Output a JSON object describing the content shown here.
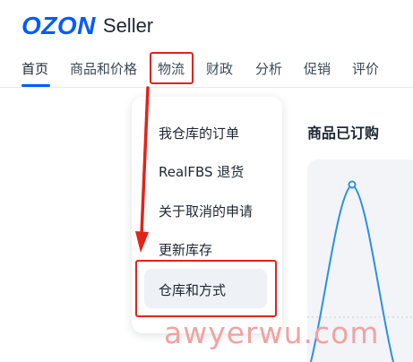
{
  "header": {
    "logo_text": "OZON",
    "logo_subtitle": "Seller"
  },
  "nav": {
    "items": [
      {
        "label": "首页",
        "active": true
      },
      {
        "label": "商品和价格",
        "active": false
      },
      {
        "label": "物流",
        "active": false,
        "highlighted": true
      },
      {
        "label": "财政",
        "active": false
      },
      {
        "label": "分析",
        "active": false
      },
      {
        "label": "促销",
        "active": false
      },
      {
        "label": "评价",
        "active": false
      }
    ]
  },
  "dropdown": {
    "items": [
      {
        "label": "我仓库的订单"
      },
      {
        "label": "RealFBS 退货"
      },
      {
        "label": "关于取消的申请"
      },
      {
        "label": "更新库存"
      },
      {
        "label": "仓库和方式",
        "highlighted": true
      }
    ]
  },
  "panel": {
    "title": "商品已订购"
  },
  "colors": {
    "brand": "#005bff",
    "annotation": "#e2231a",
    "chart_line": "#2e8fe6"
  },
  "watermark": "awyerwu.com"
}
